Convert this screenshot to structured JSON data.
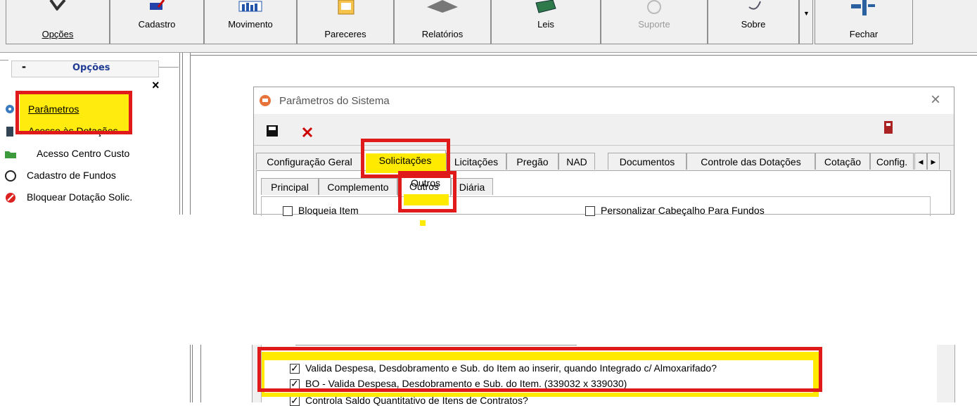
{
  "toolbar": {
    "buttons": [
      {
        "label": "Opções",
        "icon": "options-icon"
      },
      {
        "label": "Cadastro",
        "icon": "cadastro-icon"
      },
      {
        "label": "Movimento",
        "icon": "chart-icon"
      },
      {
        "label": "Pareceres",
        "icon": "document-icon"
      },
      {
        "label": "Relatórios",
        "icon": "printer-icon"
      },
      {
        "label": "Leis",
        "icon": "book-icon"
      },
      {
        "label": "Suporte",
        "icon": "support-icon"
      },
      {
        "label": "Sobre",
        "icon": "info-icon"
      },
      {
        "label": "Fechar",
        "icon": "exit-icon"
      }
    ]
  },
  "sidebar": {
    "title": "Opções",
    "collapse": "-",
    "close": "×",
    "items": [
      {
        "label": "Parâmetros",
        "icon": "gear-icon"
      },
      {
        "label": "Acesso às Dotações",
        "icon": "access-icon"
      },
      {
        "label": "Acesso Centro Custo",
        "icon": "folder-icon"
      },
      {
        "label": "Cadastro de Fundos",
        "icon": "fund-icon"
      },
      {
        "label": "Bloquear Dotação Solic.",
        "icon": "block-icon"
      }
    ]
  },
  "dialog": {
    "title": "Parâmetros do Sistema",
    "close": "×",
    "tabs": [
      "Configuração Geral",
      "Solicitações",
      "Licitações",
      "Pregão",
      "NAD",
      "Documentos",
      "Controle das Dotações",
      "Cotação",
      "Config."
    ],
    "subtabs": [
      "Principal",
      "Complemento",
      "Outros",
      "Diária"
    ],
    "checks_top": [
      {
        "label": "Bloqueia Item",
        "checked": false
      },
      {
        "label": "Personalizar Cabeçalho Para Fundos",
        "checked": false
      }
    ],
    "checks_bottom": [
      {
        "label": "Valida Despesa, Desdobramento e Sub. do Item ao inserir, quando Integrado c/ Almoxarifado?",
        "checked": true
      },
      {
        "label": "BO - Valida Despesa, Desdobramento e Sub. do Item. (339032 x 339030)",
        "checked": true
      },
      {
        "label": "Controla Saldo Quantitativo de Itens de Contratos?",
        "checked": true
      }
    ]
  },
  "colors": {
    "highlight_red": "#e01a1a",
    "highlight_yellow": "#ffea00"
  }
}
